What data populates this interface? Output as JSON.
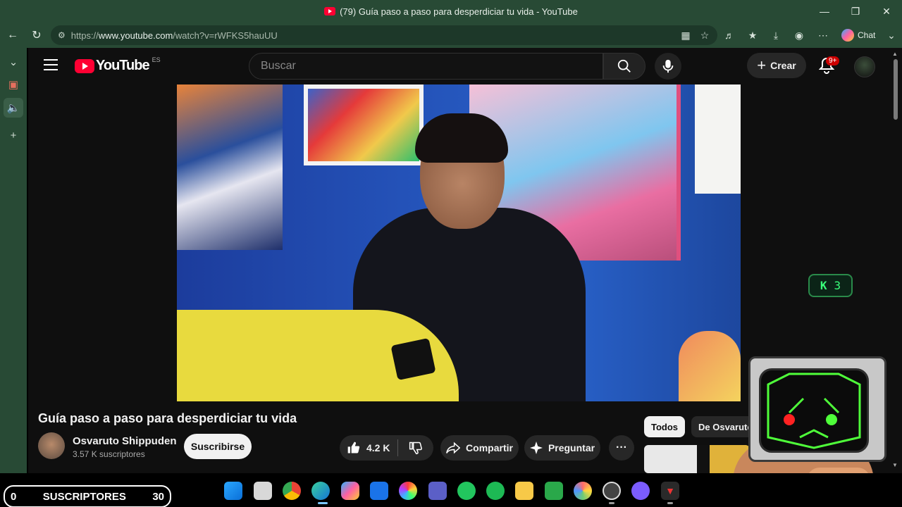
{
  "window": {
    "title": "(79) Guía paso a paso para desperdiciar tu vida - YouTube"
  },
  "browser": {
    "url_prefix": "https://",
    "url_domain": "www.youtube.com",
    "url_path": "/watch?v=rWFKS5hauUU",
    "chat_label": "Chat"
  },
  "youtube": {
    "logo_text": "YouTube",
    "country_code": "ES",
    "search_placeholder": "Buscar",
    "create_label": "Crear",
    "notifications_badge": "9+"
  },
  "video": {
    "title": "Guía paso a paso para desperdiciar tu vida",
    "channel_name": "Osvaruto Shippuden",
    "subscribers": "3.57 K suscriptores",
    "subscribe_label": "Suscribirse",
    "likes": "4.2 K",
    "share_label": "Compartir",
    "ask_label": "Preguntar"
  },
  "chips": [
    "Todos",
    "De Osvaruto"
  ],
  "overlay_counter": {
    "letter": "K",
    "value": "3"
  },
  "stream_counter": {
    "left": "0",
    "label": "SUSCRIPTORES",
    "right": "30"
  },
  "colors": {
    "browser_frame": "#284a35",
    "youtube_bg": "#0f0f0f",
    "youtube_red": "#ff0033",
    "counter_green": "#39ff7a"
  }
}
